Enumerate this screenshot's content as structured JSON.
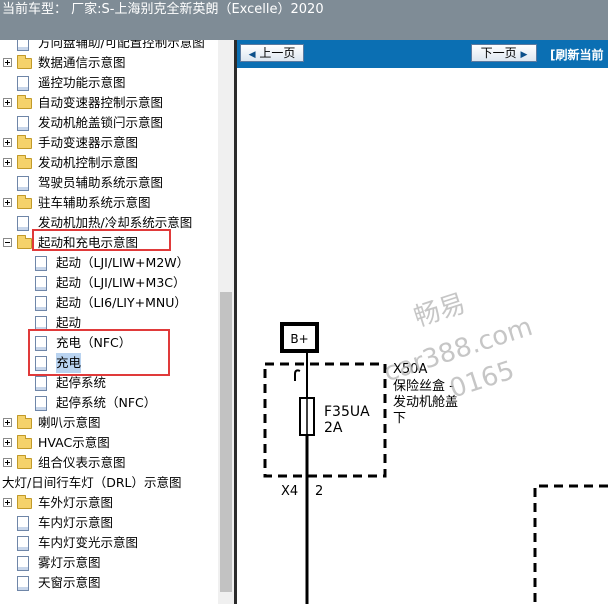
{
  "title_bar": {
    "text": "当前车型： 厂家:S-上海别克全新英朗（Excelle）2020"
  },
  "tree": {
    "items": [
      {
        "label": "方向盘辅助/可配置控制示意图",
        "type": "doc"
      },
      {
        "label": "数据通信示意图",
        "type": "folder",
        "expander": "plus"
      },
      {
        "label": "遥控功能示意图",
        "type": "doc"
      },
      {
        "label": "自动变速器控制示意图",
        "type": "folder",
        "expander": "plus"
      },
      {
        "label": "发动机舱盖锁闩示意图",
        "type": "doc"
      },
      {
        "label": "手动变速器示意图",
        "type": "folder",
        "expander": "plus"
      },
      {
        "label": "发动机控制示意图",
        "type": "folder",
        "expander": "plus"
      },
      {
        "label": "驾驶员辅助系统示意图",
        "type": "doc"
      },
      {
        "label": "驻车辅助系统示意图",
        "type": "folder",
        "expander": "plus"
      },
      {
        "label": "发动机加热/冷却系统示意图",
        "type": "doc"
      },
      {
        "label": "起动和充电示意图",
        "type": "folder",
        "expander": "minus"
      },
      {
        "label": "起动（LJI/LIW+M2W）",
        "type": "doc",
        "child": true
      },
      {
        "label": "起动（LJI/LIW+M3C）",
        "type": "doc",
        "child": true
      },
      {
        "label": "起动（LI6/LIY+MNU）",
        "type": "doc",
        "child": true
      },
      {
        "label": "起动",
        "type": "doc",
        "child": true
      },
      {
        "label": "充电（NFC）",
        "type": "doc",
        "child": true
      },
      {
        "label": "充电",
        "type": "doc",
        "child": true,
        "selected": true
      },
      {
        "label": "起停系统",
        "type": "doc",
        "child": true
      },
      {
        "label": "起停系统（NFC）",
        "type": "doc",
        "child": true
      },
      {
        "label": "喇叭示意图",
        "type": "folder",
        "expander": "plus"
      },
      {
        "label": "HVAC示意图",
        "type": "folder",
        "expander": "plus"
      },
      {
        "label": "组合仪表示意图",
        "type": "folder",
        "expander": "plus"
      },
      {
        "label": "大灯/日间行车灯（DRL）示意图",
        "type": "folder",
        "expander": "plus",
        "no_icon": true
      },
      {
        "label": "车外灯示意图",
        "type": "folder",
        "expander": "plus"
      },
      {
        "label": "车内灯示意图",
        "type": "doc"
      },
      {
        "label": "车内灯变光示意图",
        "type": "doc"
      },
      {
        "label": "雾灯示意图",
        "type": "doc"
      },
      {
        "label": "天窗示意图",
        "type": "doc"
      }
    ]
  },
  "viewer": {
    "prev_label": "上一页",
    "next_label": "下一页",
    "refresh_label": "[刷新当前"
  },
  "diagram": {
    "power_label": "B+",
    "connector_id": "X50A",
    "fuse_box_label_1": "保险丝盒 -",
    "fuse_box_label_2": "发动机舱盖",
    "fuse_box_label_3": "下",
    "fuse_name": "F35UA",
    "fuse_rating": "2A",
    "connector_ref": "X4",
    "pin": "2",
    "watermark_1": "畅易",
    "watermark_2": "car388.com",
    "watermark_3": "0165"
  },
  "colors": {
    "nav_bar": "#0b6fb3",
    "highlight_box": "#e03a3a",
    "selected_row": "#b9d3f0"
  }
}
